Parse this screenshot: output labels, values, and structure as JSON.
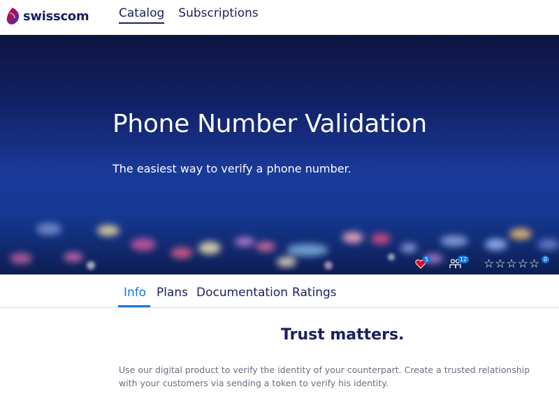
{
  "brand": {
    "name": "swisscom"
  },
  "nav": {
    "items": [
      {
        "label": "Catalog",
        "active": true
      },
      {
        "label": "Subscriptions",
        "active": false
      }
    ]
  },
  "hero": {
    "title": "Phone Number Validation",
    "subtitle": "The easiest way to verify a phone number.",
    "stats": {
      "likes": {
        "icon": "heart-icon",
        "count": "5"
      },
      "subscribers": {
        "icon": "users-icon",
        "count": "12"
      },
      "rating": {
        "icon": "star-icon",
        "stars_filled": 0,
        "stars_total": 5,
        "count": "0"
      }
    }
  },
  "tabs": [
    {
      "label": "Info",
      "active": true
    },
    {
      "label": "Plans",
      "active": false
    },
    {
      "label": "Documentation",
      "active": false
    },
    {
      "label": "Ratings",
      "active": false
    }
  ],
  "content": {
    "heading": "Trust matters.",
    "body": "Use our digital product to verify the identity of your counterpart. Create a trusted relationship with your customers via sending a token to verify his identity."
  },
  "colors": {
    "brand_navy": "#1b1f5f",
    "accent_blue": "#1a73d9",
    "logo_red": "#e2001a",
    "body_text": "#6a6e80"
  }
}
